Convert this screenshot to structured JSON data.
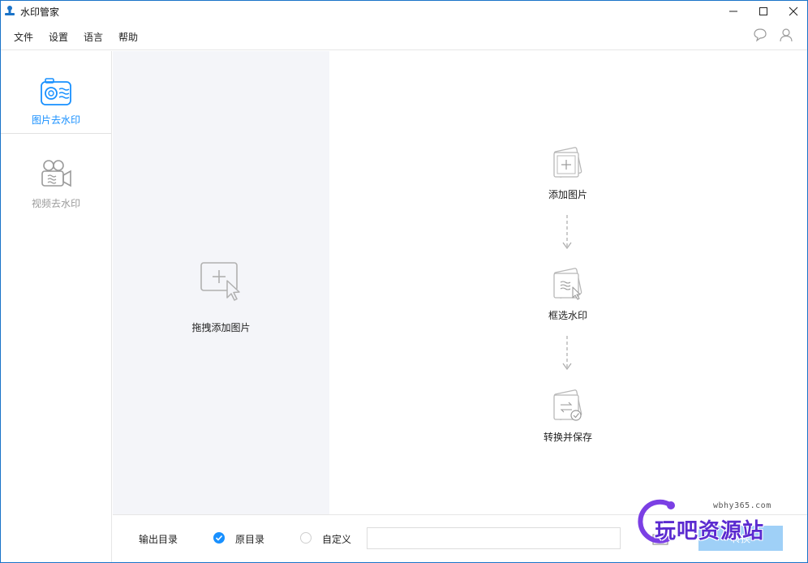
{
  "window": {
    "title": "水印管家",
    "accent_color": "#1890ff",
    "controls": {
      "minimize": "minimize-icon",
      "maximize": "maximize-icon",
      "close": "close-icon"
    }
  },
  "menu": {
    "items": [
      {
        "label": "文件"
      },
      {
        "label": "设置"
      },
      {
        "label": "语言"
      },
      {
        "label": "帮助"
      }
    ],
    "right_icons": [
      "chat-icon",
      "user-icon"
    ]
  },
  "sidebar": {
    "items": [
      {
        "label": "图片去水印",
        "icon": "photo-watermark-icon",
        "active": true,
        "color": "#1890ff"
      },
      {
        "label": "视频去水印",
        "icon": "video-camera-icon",
        "active": false,
        "color": "#9a9a9a"
      }
    ]
  },
  "drop_area": {
    "label": "拖拽添加图片",
    "icon": "add-image-cursor-icon"
  },
  "steps": [
    {
      "label": "添加图片",
      "icon": "add-picture-icon"
    },
    {
      "label": "框选水印",
      "icon": "select-watermark-icon"
    },
    {
      "label": "转换并保存",
      "icon": "convert-save-icon"
    }
  ],
  "bottom": {
    "output_label": "输出目录",
    "option_original": "原目录",
    "option_custom": "自定义",
    "path_value": "",
    "convert_label": "转换",
    "convert_color": "#9fd0f7"
  },
  "watermark": {
    "url": "wbhy365.com",
    "text": "玩吧资源站"
  }
}
